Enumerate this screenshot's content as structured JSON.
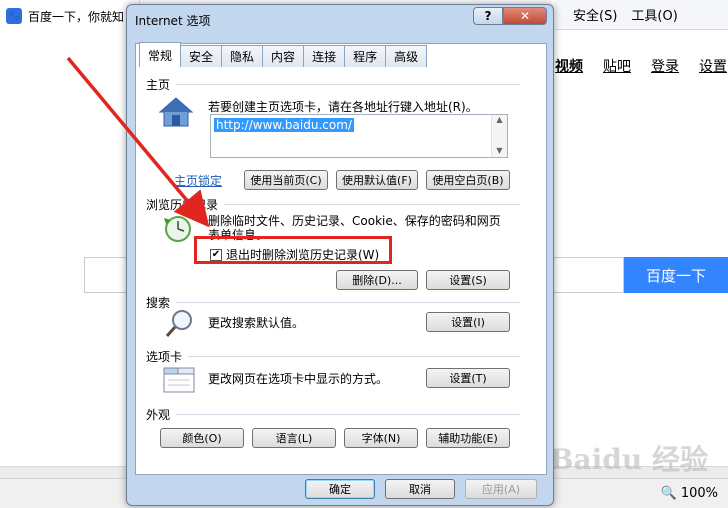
{
  "browser": {
    "tab_title": "百度一下，你就知",
    "toolbar": {
      "safety": "安全(S)",
      "tools": "工具(O)"
    },
    "nav": [
      "视频",
      "贴吧",
      "登录",
      "设置"
    ],
    "search_button": "百度一下",
    "zoom": "100%",
    "watermark": "Baidu 经验"
  },
  "dialog": {
    "title": "Internet 选项",
    "help_btn": "?",
    "close_btn": "✕",
    "tabs": [
      "常规",
      "安全",
      "隐私",
      "内容",
      "连接",
      "程序",
      "高级"
    ],
    "active_tab": "常规",
    "home": {
      "header": "主页",
      "desc": "若要创建主页选项卡，请在各地址行键入地址(R)。",
      "url": "http://www.baidu.com/",
      "lock_link": "主页锁定",
      "btn_current": "使用当前页(C)",
      "btn_default": "使用默认值(F)",
      "btn_blank": "使用空白页(B)"
    },
    "history": {
      "header": "浏览历史记录",
      "desc_line1": "删除临时文件、历史记录、Cookie、保存的密码和网页",
      "desc_line2": "表单信息。",
      "checkbox_label": "退出时删除浏览历史记录(W)",
      "checkbox_checked": true,
      "btn_delete": "删除(D)...",
      "btn_settings": "设置(S)"
    },
    "search": {
      "header": "搜索",
      "desc": "更改搜索默认值。",
      "btn_settings": "设置(I)"
    },
    "tabsec": {
      "header": "选项卡",
      "desc": "更改网页在选项卡中显示的方式。",
      "btn_settings": "设置(T)"
    },
    "appearance": {
      "header": "外观",
      "btn_colors": "颜色(O)",
      "btn_languages": "语言(L)",
      "btn_fonts": "字体(N)",
      "btn_accessibility": "辅助功能(E)"
    },
    "footer": {
      "ok": "确定",
      "cancel": "取消",
      "apply": "应用(A)"
    }
  },
  "colors": {
    "annotation": "#e0261e",
    "accent": "#3385ff"
  }
}
